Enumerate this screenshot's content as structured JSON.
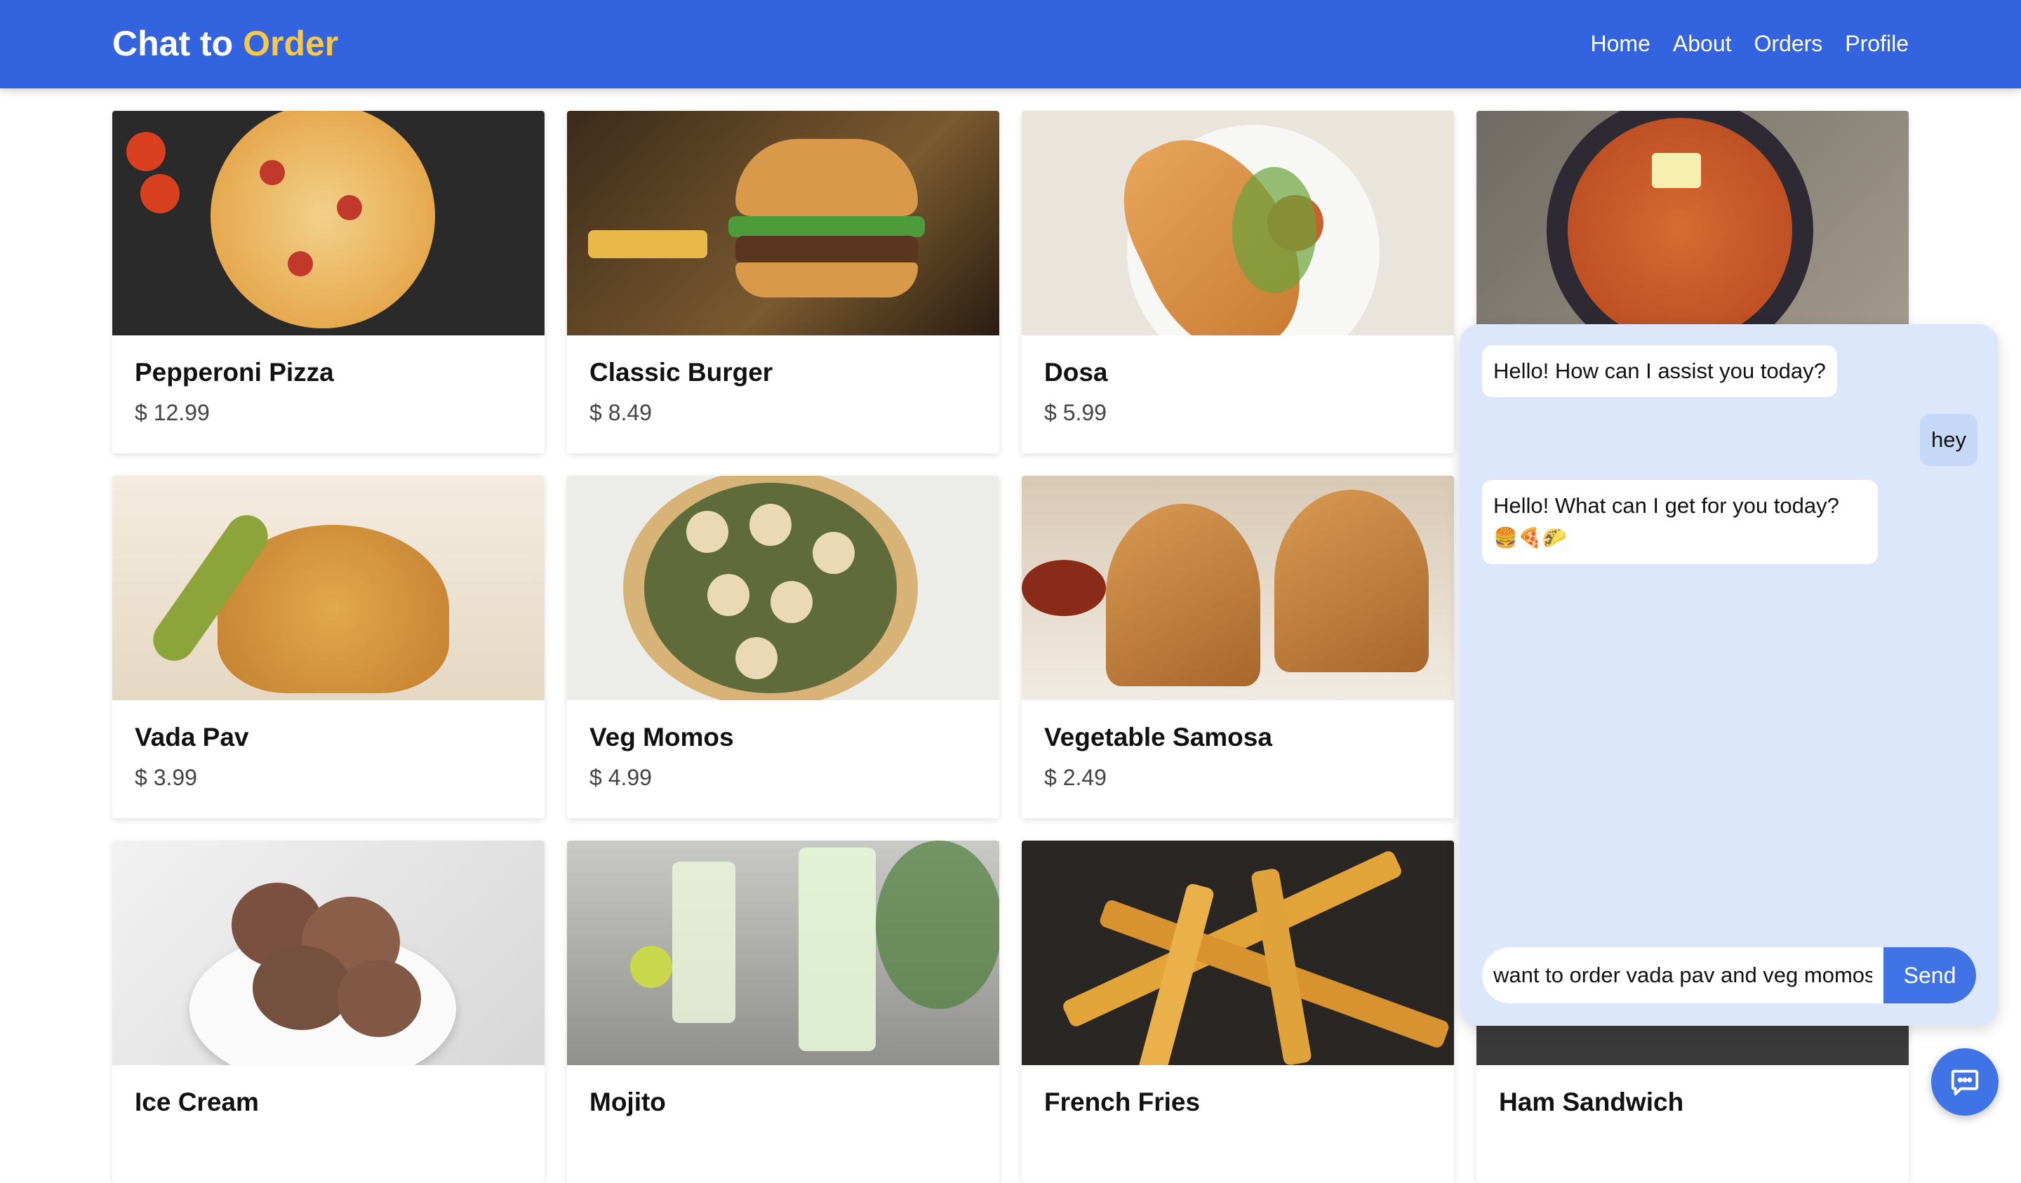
{
  "header": {
    "brand_primary": "Chat to",
    "brand_accent": "Order",
    "nav": [
      "Home",
      "About",
      "Orders",
      "Profile"
    ],
    "colors": {
      "bar": "#3463e0",
      "accent": "#f7c948"
    }
  },
  "menu": [
    {
      "name": "Pepperoni Pizza",
      "price": "$ 12.99"
    },
    {
      "name": "Classic Burger",
      "price": "$ 8.49"
    },
    {
      "name": "Dosa",
      "price": "$ 5.99"
    },
    {
      "name": "Vada Pav",
      "price": "$ 3.99"
    },
    {
      "name": "Veg Momos",
      "price": "$ 4.99"
    },
    {
      "name": "Vegetable Samosa",
      "price": "$ 2.49"
    },
    {
      "name": "Ice Cream"
    },
    {
      "name": "Mojito"
    },
    {
      "name": "French Fries"
    },
    {
      "name": "Ham Sandwich"
    }
  ],
  "chat": {
    "messages": [
      {
        "from": "bot",
        "text": "Hello! How can I assist you today?"
      },
      {
        "from": "user",
        "text": "hey"
      },
      {
        "from": "bot",
        "text": "Hello! What can I get for you today?",
        "emoji": "🍔🍕🌮"
      }
    ],
    "input_value": "want to order vada pav and veg momos",
    "send_label": "Send"
  },
  "fab": {
    "icon": "chat-bubble-icon"
  }
}
